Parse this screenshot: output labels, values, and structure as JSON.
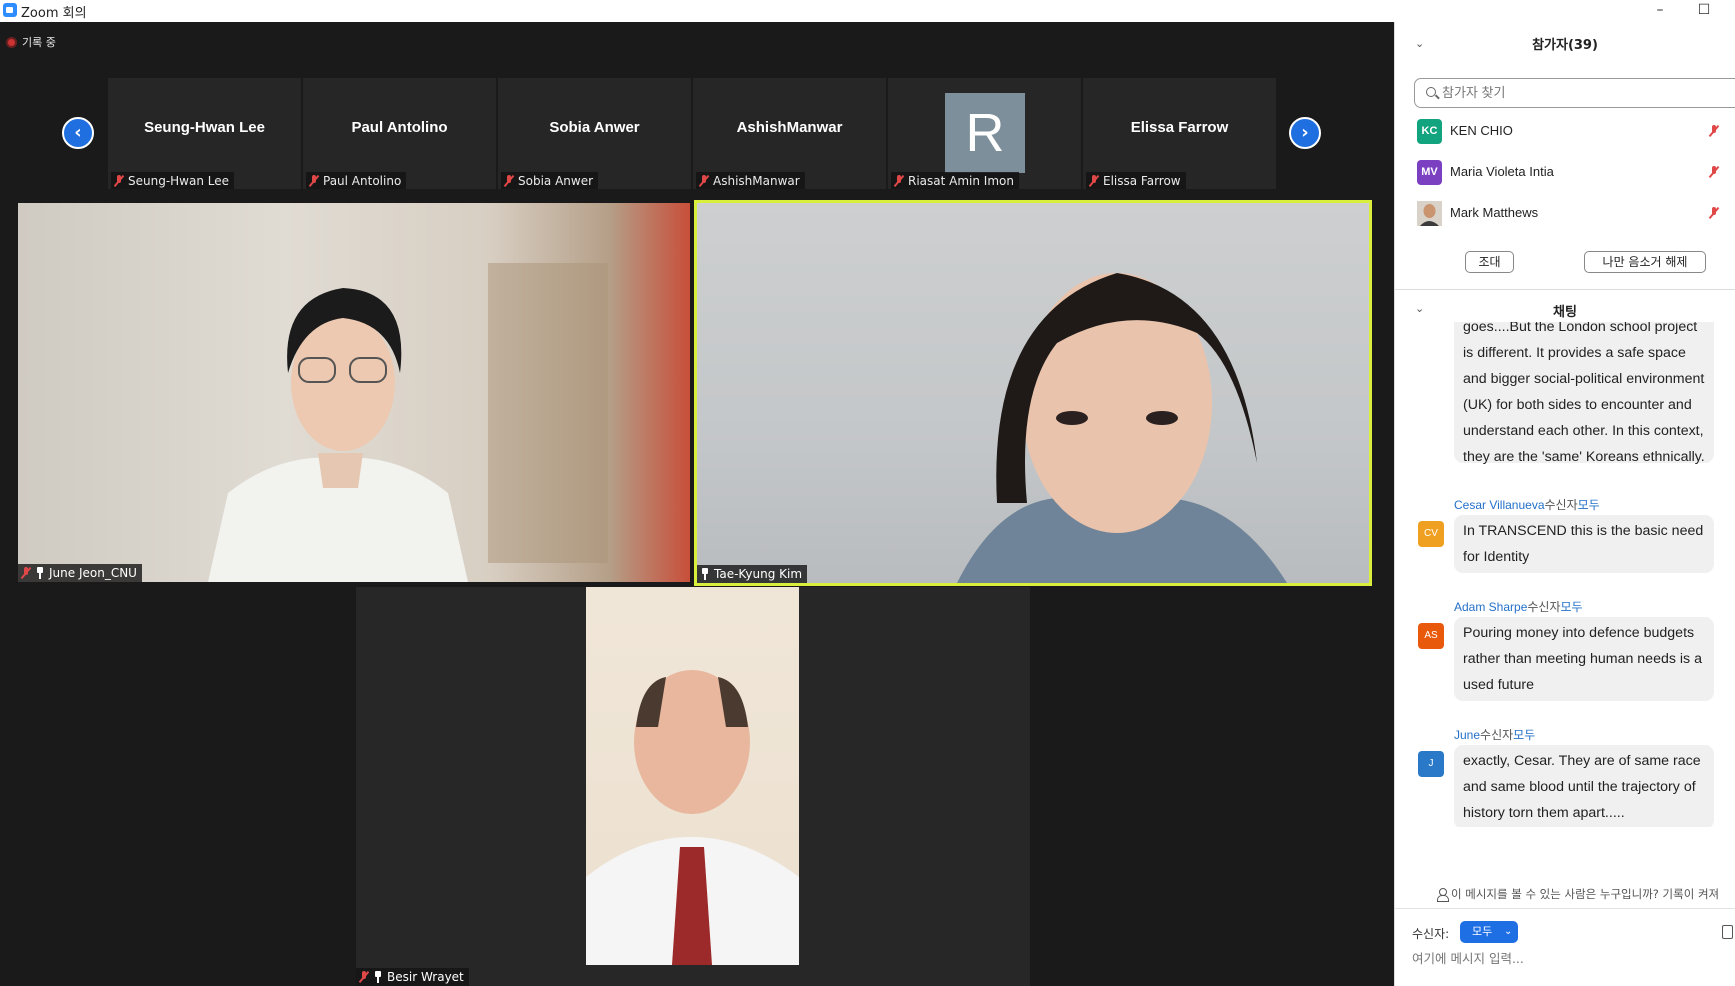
{
  "window": {
    "title": "Zoom 회의"
  },
  "recording": {
    "label": "기록 중"
  },
  "gallery_strip": [
    {
      "name": "Seung-Hwan Lee",
      "label": "Seung-Hwan Lee"
    },
    {
      "name": "Paul Antolino",
      "label": "Paul Antolino"
    },
    {
      "name": "Sobia Anwer",
      "label": "Sobia Anwer"
    },
    {
      "name": "AshishManwar",
      "label": "AshishManwar"
    },
    {
      "avatar_letter": "R",
      "label": "Riasat Amin Imon"
    },
    {
      "name": "Elissa Farrow",
      "label": "Elissa Farrow"
    }
  ],
  "videos": [
    {
      "label": "June Jeon_CNU"
    },
    {
      "label": "Tae-Kyung Kim"
    },
    {
      "label": "Besir Wrayet"
    }
  ],
  "participants_panel": {
    "title": "참가자(39)",
    "search_placeholder": "참가자 찾기",
    "items": [
      {
        "initials": "KC",
        "name": "KEN CHIO",
        "color": "#12a37f"
      },
      {
        "initials": "MV",
        "name": "Maria Violeta Intia",
        "color": "#7b3fc2"
      },
      {
        "initials": "",
        "name": "Mark Matthews",
        "color": "#8a6a4a"
      }
    ],
    "invite_label": "조대",
    "unmute_label": "나만 음소거 해제"
  },
  "chat_panel": {
    "title": "채팅",
    "messages": [
      {
        "sender": "",
        "text": "goes....But the London school project is different. It provides a safe space and bigger social-political environment (UK) for both sides to encounter and understand each other. In this context, they are the 'same' Koreans ethnically."
      },
      {
        "sender": "Cesar Villanueva",
        "to": "수신자",
        "recipient": "모두",
        "initials": "CV",
        "color": "#f0a020",
        "text": "In TRANSCEND this is the basic need for Identity"
      },
      {
        "sender": "Adam Sharpe",
        "to": "수신자",
        "recipient": "모두",
        "initials": "AS",
        "color": "#e8590c",
        "text": "Pouring money into defence budgets rather than meeting human needs is a used future"
      },
      {
        "sender": "June",
        "to": "수신자",
        "recipient": "모두",
        "initials": "J",
        "color": "#2a78c8",
        "text": "exactly, Cesar. They are of same race and same blood until the trajectory of history torn them apart....."
      }
    ],
    "visibility_notice": "이 메시지를 볼 수 있는 사람은 누구입니까? 기록이 켜져",
    "to_label": "수신자:",
    "to_value": "모두",
    "input_placeholder": "여기에 메시지 입력..."
  }
}
